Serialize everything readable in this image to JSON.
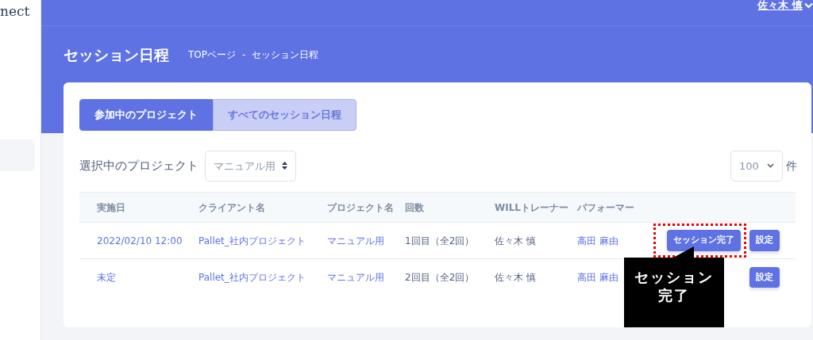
{
  "sidebar": {
    "logo_text": "nect",
    "items": [
      {
        "selected": true
      }
    ]
  },
  "topbar": {
    "user": "佐々木 慎"
  },
  "page": {
    "title": "セッション日程",
    "breadcrumb": [
      "TOPページ",
      "セッション日程"
    ],
    "breadcrumb_separator": "-"
  },
  "tabs": [
    {
      "label": "参加中のプロジェクト",
      "selected": true
    },
    {
      "label": "すべてのセッション日程",
      "selected": false
    }
  ],
  "filter": {
    "label": "選択中のプロジェクト",
    "value": "マニュアル用",
    "page_size": "100",
    "page_size_unit": "件"
  },
  "table": {
    "columns": [
      "実施日",
      "クライアント名",
      "プロジェクト名",
      "回数",
      "WILLトレーナー",
      "パフォーマー"
    ],
    "rows": [
      {
        "date": "2022/02/10 12:00",
        "client": "Pallet_社内プロジェクト",
        "project": "マニュアル用",
        "count": "1回目（全2回）",
        "trainer": "佐々木 慎",
        "performer": "高田 麻由",
        "buttons": [
          {
            "label": "セッション完了",
            "highlighted": true
          },
          {
            "label": "設定",
            "highlighted": false
          }
        ]
      },
      {
        "date": "未定",
        "client": "Pallet_社内プロジェクト",
        "project": "マニュアル用",
        "count": "2回目（全2回）",
        "trainer": "佐々木 慎",
        "performer": "高田 麻由",
        "buttons": [
          {
            "label": "設定",
            "highlighted": false
          }
        ]
      }
    ]
  },
  "callout": {
    "text": "セッション完了"
  }
}
